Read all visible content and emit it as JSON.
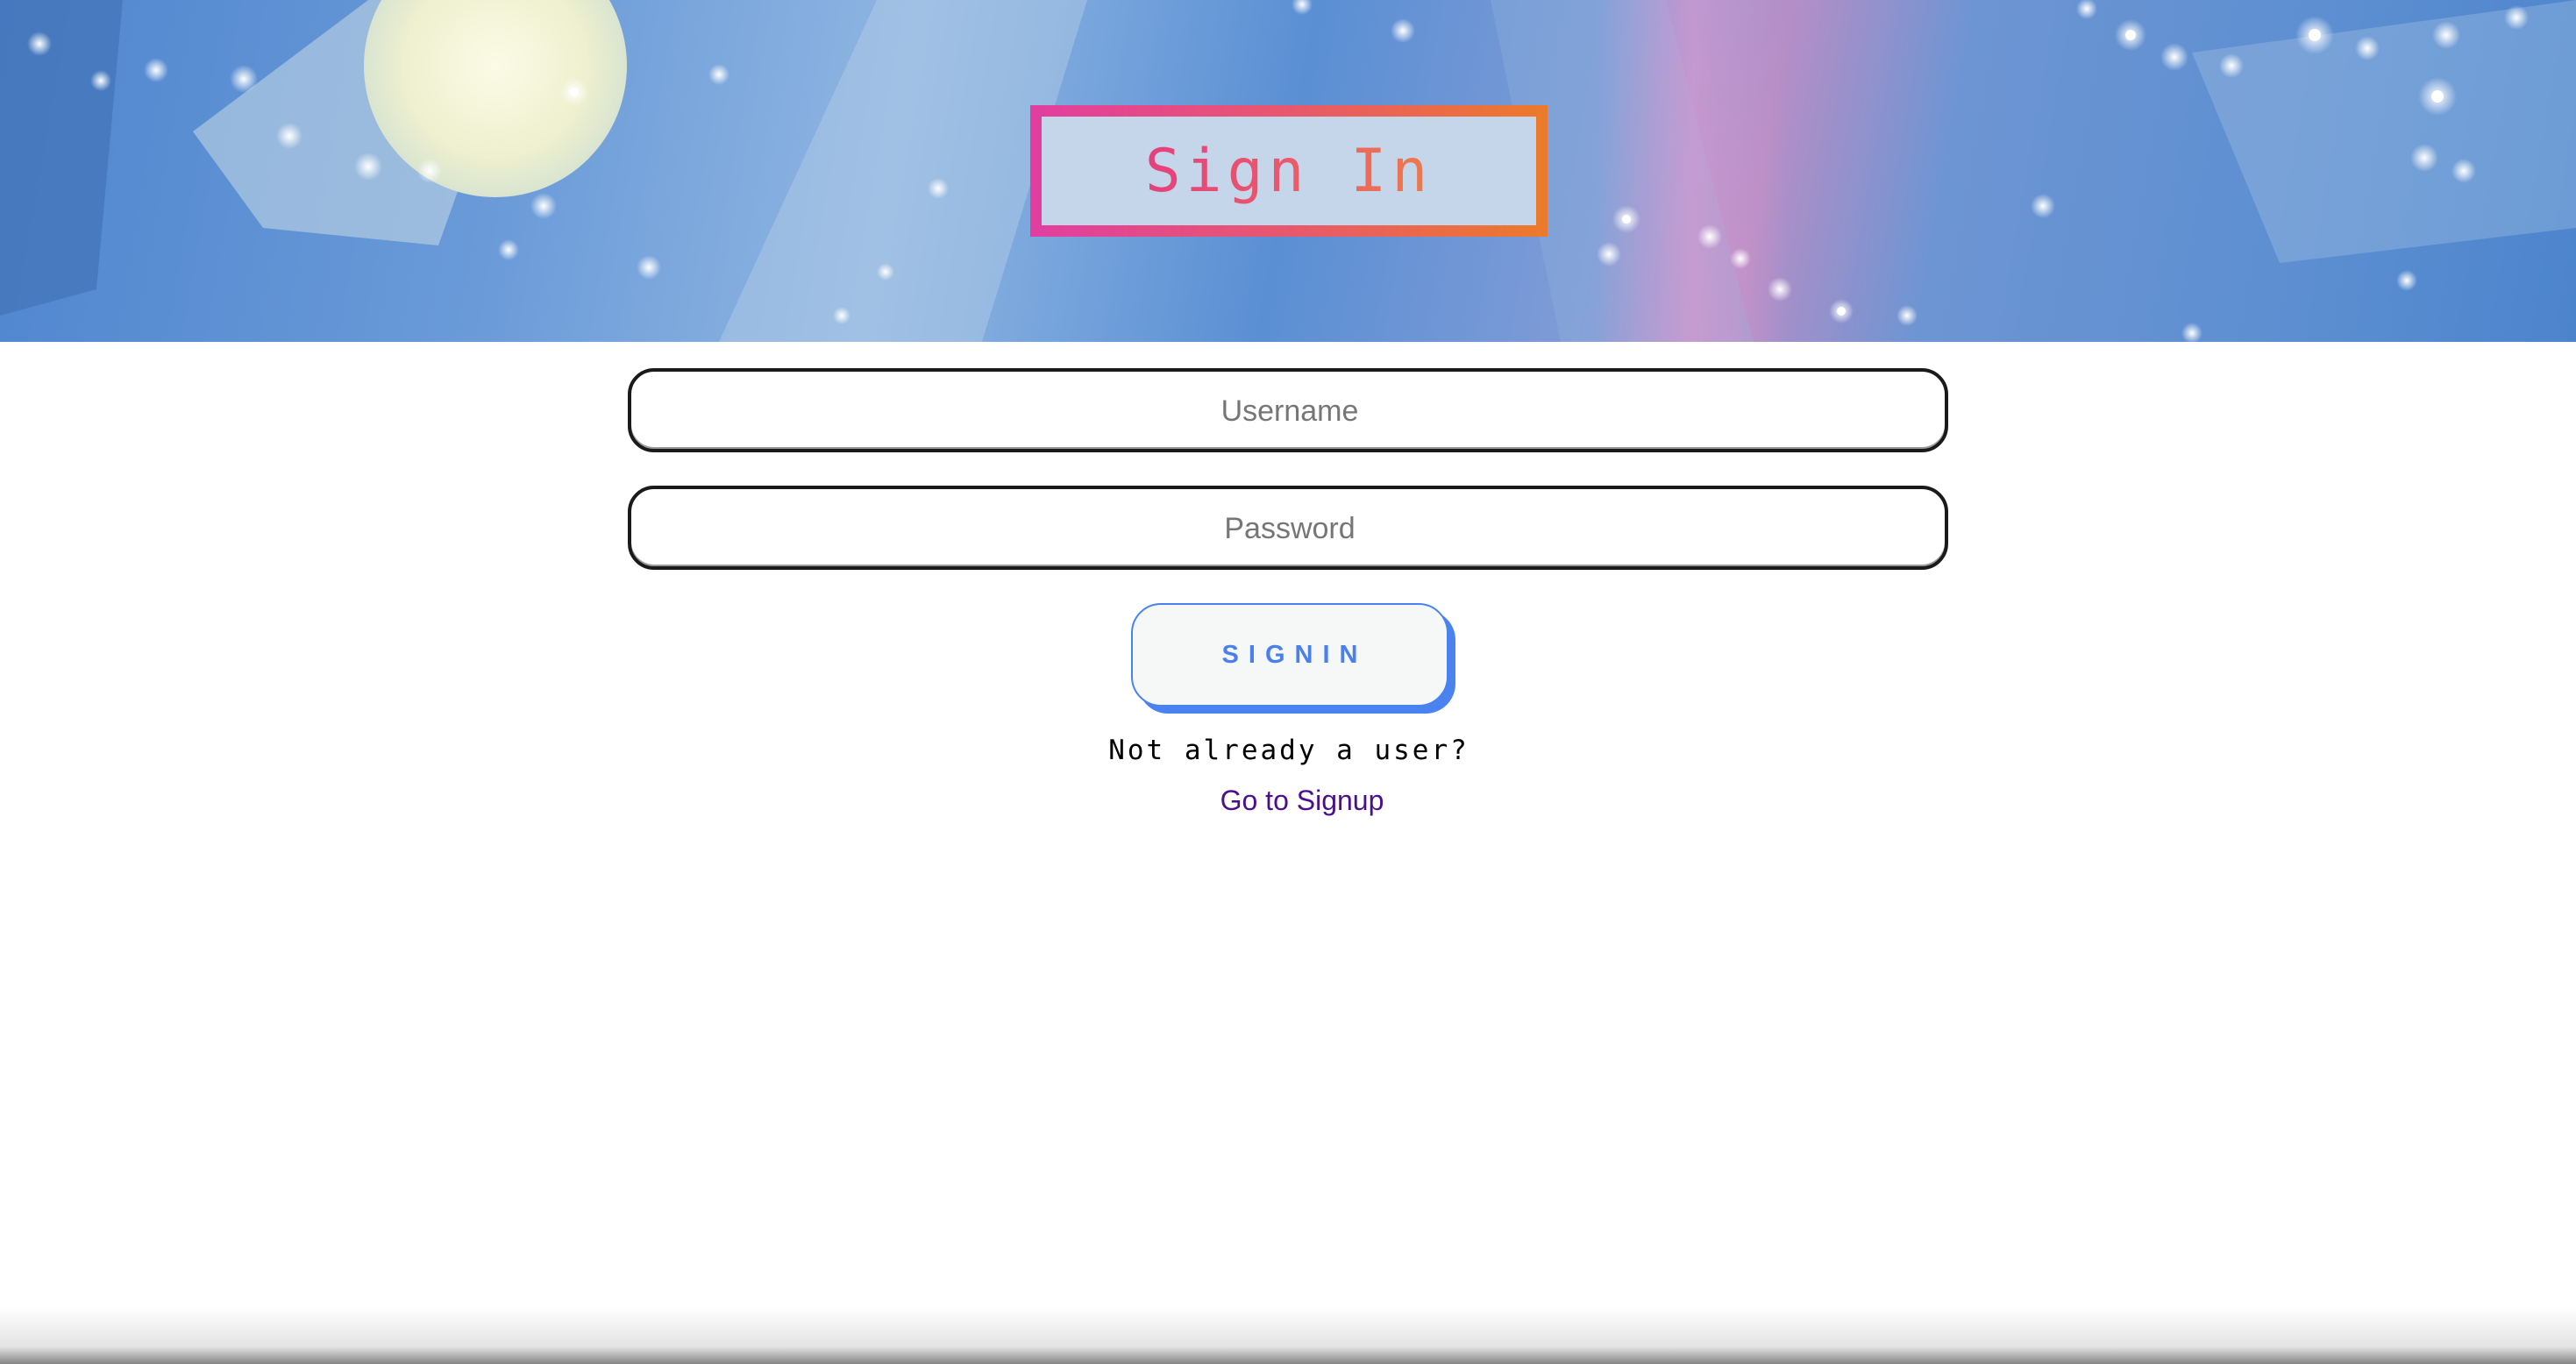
{
  "header": {
    "title": "Sign In"
  },
  "form": {
    "username_placeholder": "Username",
    "password_placeholder": "Password",
    "submit_label": "SIGNIN"
  },
  "footer": {
    "prompt": "Not already a user?",
    "signup_link": "Go to Signup"
  },
  "colors": {
    "title_gradient_start": "#e13ea0",
    "title_gradient_end": "#ec7a2a",
    "button_accent": "#4a82f0",
    "link_color": "#4b0f8e"
  }
}
